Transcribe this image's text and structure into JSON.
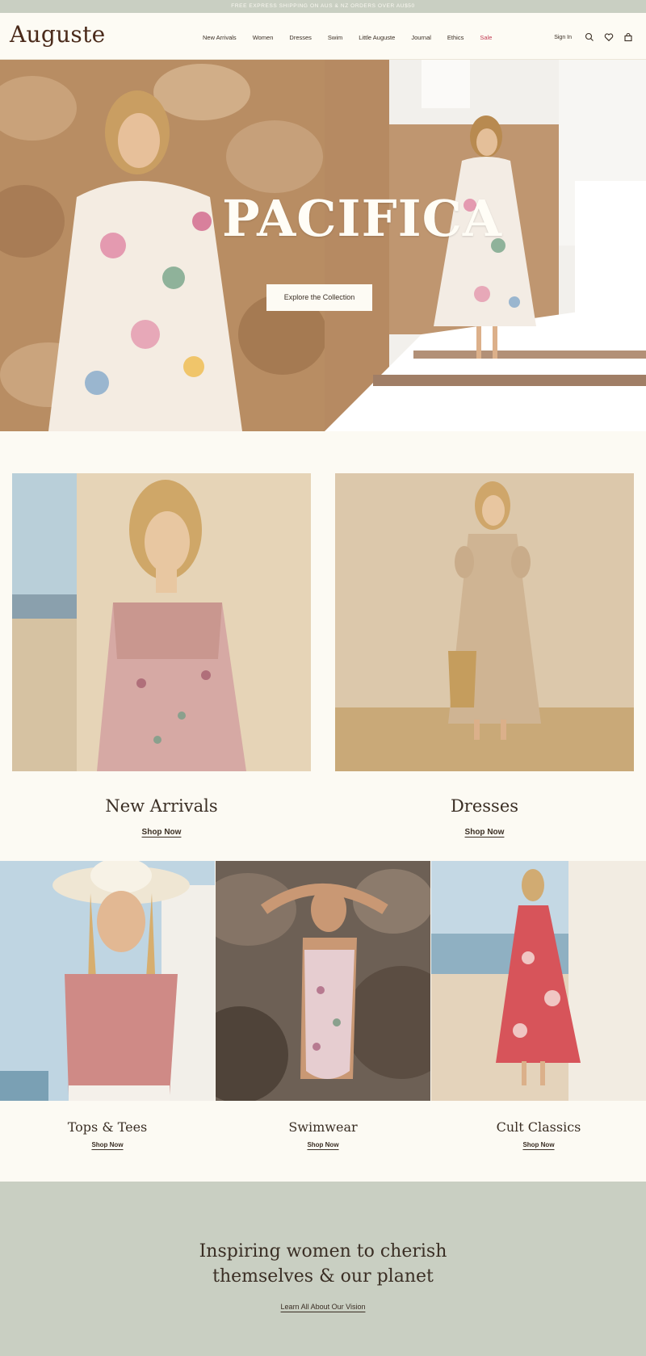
{
  "announcement": "FREE EXPRESS SHIPPING ON AUS & NZ ORDERS OVER AU$50",
  "brand": "Auguste",
  "nav": [
    "New Arrivals",
    "Women",
    "Dresses",
    "Swim",
    "Little Auguste",
    "Journal",
    "Ethics",
    "Sale"
  ],
  "header": {
    "sign_in": "Sign In",
    "icons": [
      "search-icon",
      "heart-icon",
      "bag-icon"
    ]
  },
  "hero": {
    "title": "PACIFICA",
    "button": "Explore the Collection"
  },
  "featured": [
    {
      "title": "New Arrivals",
      "link": "Shop Now"
    },
    {
      "title": "Dresses",
      "link": "Shop Now"
    }
  ],
  "categories": [
    {
      "title": "Tops & Tees",
      "link": "Shop Now"
    },
    {
      "title": "Swimwear",
      "link": "Shop Now"
    },
    {
      "title": "Cult Classics",
      "link": "Shop Now"
    }
  ],
  "vision": {
    "line1": "Inspiring women to cherish",
    "line2": "themselves & our planet",
    "link": "Learn All About Our Vision"
  },
  "colors": {
    "announcement_bg": "#c9cfc2",
    "page_bg": "#fcfaf3",
    "sale": "#c23b53",
    "vision_bg": "#c9cfc2"
  }
}
